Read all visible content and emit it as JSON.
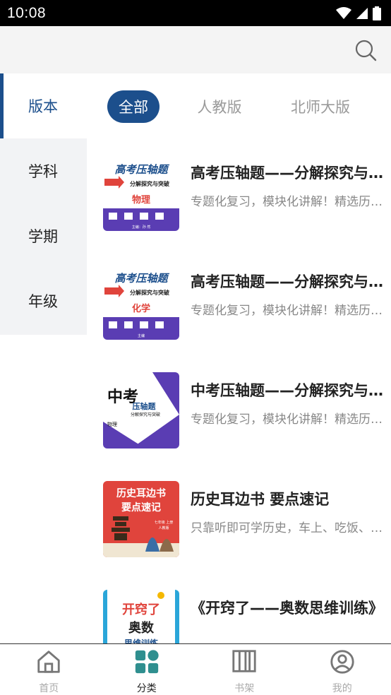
{
  "status": {
    "time": "10:08"
  },
  "sidebar": {
    "items": [
      {
        "label": "版本",
        "active": true
      },
      {
        "label": "学科",
        "active": false
      },
      {
        "label": "学期",
        "active": false
      },
      {
        "label": "年级",
        "active": false
      }
    ]
  },
  "tabs": [
    {
      "label": "全部",
      "active": true
    },
    {
      "label": "人教版",
      "active": false
    },
    {
      "label": "北师大版",
      "active": false
    }
  ],
  "books": [
    {
      "title": "高考压轴题——分解探究与突破",
      "desc": "专题化复习，模块化讲解！精选历年真题",
      "cover": {
        "heading": "高考压轴题",
        "sub": "分解探究与突破",
        "subject": "物理",
        "editor": "主编：孙 然"
      }
    },
    {
      "title": "高考压轴题——分解探究与突破",
      "desc": "专题化复习，模块化讲解！精选历年真题",
      "cover": {
        "heading": "高考压轴题",
        "sub": "分解探究与突破",
        "subject": "化学",
        "editor": "主编"
      }
    },
    {
      "title": "中考压轴题——分解探究与突破",
      "desc": "专题化复习，模块化讲解！精选历年真题",
      "cover": {
        "heading": "中考",
        "sub": "压轴题",
        "subject": "物理",
        "editor": "分解探究与突破"
      }
    },
    {
      "title": "历史耳边书 要点速记",
      "desc": "只靠听即可学历史，车上、吃饭、睡前都能学",
      "cover": {
        "heading": "历史耳边书",
        "sub": "要点速记",
        "subject": "七年级 上册",
        "editor": "人教版"
      }
    },
    {
      "title": "《开窍了——奥数思维训练》",
      "desc": "",
      "cover": {
        "heading": "开窍了",
        "sub": "奥数",
        "subject": "思维训练",
        "editor": ""
      }
    }
  ],
  "nav": [
    {
      "label": "首页",
      "icon": "home-icon",
      "active": false
    },
    {
      "label": "分类",
      "icon": "category-icon",
      "active": true
    },
    {
      "label": "书架",
      "icon": "bookshelf-icon",
      "active": false
    },
    {
      "label": "我的",
      "icon": "profile-icon",
      "active": false
    }
  ],
  "colors": {
    "accent": "#1c4f8c",
    "nav_active": "#2f8f8f",
    "cover_purple": "#5a3db3",
    "cover_red": "#e0443c"
  }
}
